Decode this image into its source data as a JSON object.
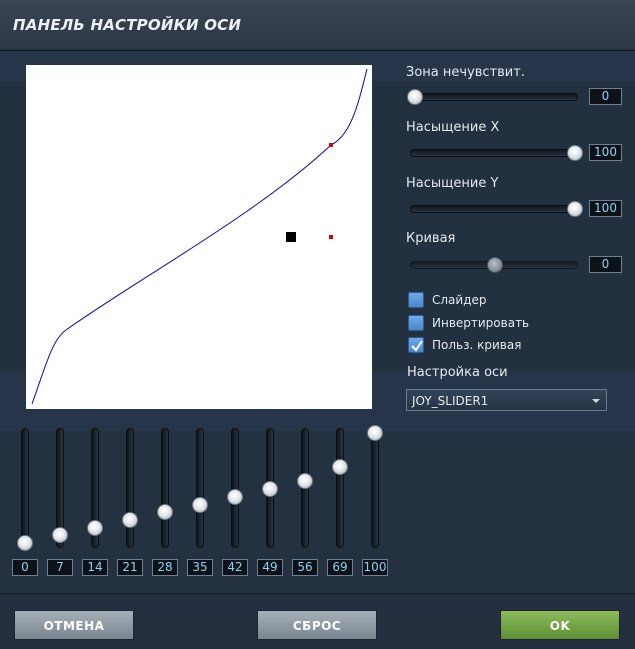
{
  "title": "ПАНЕЛЬ НАСТРОЙКИ ОСИ",
  "accent_color": "#4a86cc",
  "curve_color": "#0a0aa8",
  "marker_color": "#e00000",
  "controls": {
    "deadzone": {
      "label": "Зона нечувствит.",
      "value": "0",
      "level": 0
    },
    "saturation_x": {
      "label": "Насыщение X",
      "value": "100",
      "level": 100
    },
    "saturation_y": {
      "label": "Насыщение Y",
      "value": "100",
      "level": 100
    },
    "curve": {
      "label": "Кривая",
      "value": "0",
      "level": 50,
      "enabled": false
    }
  },
  "checkboxes": [
    {
      "label": "Слайдер",
      "checked": false
    },
    {
      "label": "Инвертировать",
      "checked": false
    },
    {
      "label": "Польз. кривая",
      "checked": true
    }
  ],
  "axis_setting": {
    "label": "Настройка оси",
    "selected": "JOY_SLIDER1"
  },
  "curve_points": [
    {
      "label": "0",
      "value": 0
    },
    {
      "label": "7",
      "value": 7
    },
    {
      "label": "14",
      "value": 14
    },
    {
      "label": "21",
      "value": 21
    },
    {
      "label": "28",
      "value": 28
    },
    {
      "label": "35",
      "value": 35
    },
    {
      "label": "42",
      "value": 42
    },
    {
      "label": "49",
      "value": 49
    },
    {
      "label": "56",
      "value": 56
    },
    {
      "label": "69",
      "value": 69
    },
    {
      "label": "100",
      "value": 100
    }
  ],
  "buttons": {
    "cancel": "ОТМЕНА",
    "reset": "СБРОС",
    "ok": "OK"
  }
}
